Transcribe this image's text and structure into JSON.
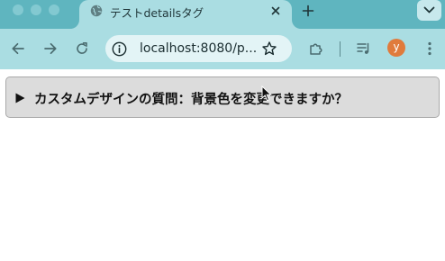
{
  "browser": {
    "tab": {
      "title": "テストdetailsタグ",
      "favicon": "globe-icon"
    },
    "toolbar": {
      "url": "localhost:8080/p...",
      "profile_initial": "y"
    },
    "colors": {
      "tabstrip": "#5fb5bf",
      "toolbar": "#aadde2",
      "omnibox": "#e3f4f6",
      "avatar": "#e07b3c"
    }
  },
  "page": {
    "details": {
      "summary": "カスタムデザインの質問：背景色を変更できますか？",
      "open": false
    }
  }
}
